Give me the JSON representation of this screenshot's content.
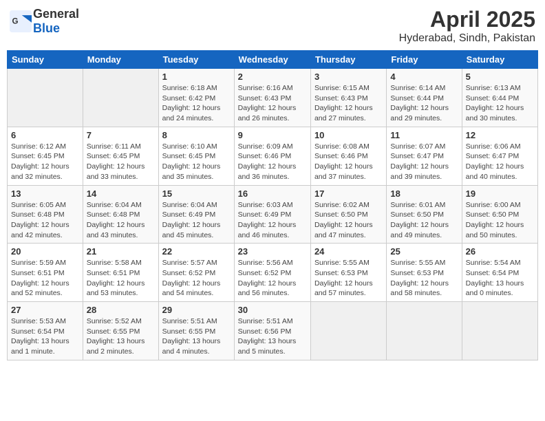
{
  "header": {
    "logo_general": "General",
    "logo_blue": "Blue",
    "month_title": "April 2025",
    "location": "Hyderabad, Sindh, Pakistan"
  },
  "weekdays": [
    "Sunday",
    "Monday",
    "Tuesday",
    "Wednesday",
    "Thursday",
    "Friday",
    "Saturday"
  ],
  "weeks": [
    [
      {
        "day": "",
        "info": ""
      },
      {
        "day": "",
        "info": ""
      },
      {
        "day": "1",
        "info": "Sunrise: 6:18 AM\nSunset: 6:42 PM\nDaylight: 12 hours\nand 24 minutes."
      },
      {
        "day": "2",
        "info": "Sunrise: 6:16 AM\nSunset: 6:43 PM\nDaylight: 12 hours\nand 26 minutes."
      },
      {
        "day": "3",
        "info": "Sunrise: 6:15 AM\nSunset: 6:43 PM\nDaylight: 12 hours\nand 27 minutes."
      },
      {
        "day": "4",
        "info": "Sunrise: 6:14 AM\nSunset: 6:44 PM\nDaylight: 12 hours\nand 29 minutes."
      },
      {
        "day": "5",
        "info": "Sunrise: 6:13 AM\nSunset: 6:44 PM\nDaylight: 12 hours\nand 30 minutes."
      }
    ],
    [
      {
        "day": "6",
        "info": "Sunrise: 6:12 AM\nSunset: 6:45 PM\nDaylight: 12 hours\nand 32 minutes."
      },
      {
        "day": "7",
        "info": "Sunrise: 6:11 AM\nSunset: 6:45 PM\nDaylight: 12 hours\nand 33 minutes."
      },
      {
        "day": "8",
        "info": "Sunrise: 6:10 AM\nSunset: 6:45 PM\nDaylight: 12 hours\nand 35 minutes."
      },
      {
        "day": "9",
        "info": "Sunrise: 6:09 AM\nSunset: 6:46 PM\nDaylight: 12 hours\nand 36 minutes."
      },
      {
        "day": "10",
        "info": "Sunrise: 6:08 AM\nSunset: 6:46 PM\nDaylight: 12 hours\nand 37 minutes."
      },
      {
        "day": "11",
        "info": "Sunrise: 6:07 AM\nSunset: 6:47 PM\nDaylight: 12 hours\nand 39 minutes."
      },
      {
        "day": "12",
        "info": "Sunrise: 6:06 AM\nSunset: 6:47 PM\nDaylight: 12 hours\nand 40 minutes."
      }
    ],
    [
      {
        "day": "13",
        "info": "Sunrise: 6:05 AM\nSunset: 6:48 PM\nDaylight: 12 hours\nand 42 minutes."
      },
      {
        "day": "14",
        "info": "Sunrise: 6:04 AM\nSunset: 6:48 PM\nDaylight: 12 hours\nand 43 minutes."
      },
      {
        "day": "15",
        "info": "Sunrise: 6:04 AM\nSunset: 6:49 PM\nDaylight: 12 hours\nand 45 minutes."
      },
      {
        "day": "16",
        "info": "Sunrise: 6:03 AM\nSunset: 6:49 PM\nDaylight: 12 hours\nand 46 minutes."
      },
      {
        "day": "17",
        "info": "Sunrise: 6:02 AM\nSunset: 6:50 PM\nDaylight: 12 hours\nand 47 minutes."
      },
      {
        "day": "18",
        "info": "Sunrise: 6:01 AM\nSunset: 6:50 PM\nDaylight: 12 hours\nand 49 minutes."
      },
      {
        "day": "19",
        "info": "Sunrise: 6:00 AM\nSunset: 6:50 PM\nDaylight: 12 hours\nand 50 minutes."
      }
    ],
    [
      {
        "day": "20",
        "info": "Sunrise: 5:59 AM\nSunset: 6:51 PM\nDaylight: 12 hours\nand 52 minutes."
      },
      {
        "day": "21",
        "info": "Sunrise: 5:58 AM\nSunset: 6:51 PM\nDaylight: 12 hours\nand 53 minutes."
      },
      {
        "day": "22",
        "info": "Sunrise: 5:57 AM\nSunset: 6:52 PM\nDaylight: 12 hours\nand 54 minutes."
      },
      {
        "day": "23",
        "info": "Sunrise: 5:56 AM\nSunset: 6:52 PM\nDaylight: 12 hours\nand 56 minutes."
      },
      {
        "day": "24",
        "info": "Sunrise: 5:55 AM\nSunset: 6:53 PM\nDaylight: 12 hours\nand 57 minutes."
      },
      {
        "day": "25",
        "info": "Sunrise: 5:55 AM\nSunset: 6:53 PM\nDaylight: 12 hours\nand 58 minutes."
      },
      {
        "day": "26",
        "info": "Sunrise: 5:54 AM\nSunset: 6:54 PM\nDaylight: 13 hours\nand 0 minutes."
      }
    ],
    [
      {
        "day": "27",
        "info": "Sunrise: 5:53 AM\nSunset: 6:54 PM\nDaylight: 13 hours\nand 1 minute."
      },
      {
        "day": "28",
        "info": "Sunrise: 5:52 AM\nSunset: 6:55 PM\nDaylight: 13 hours\nand 2 minutes."
      },
      {
        "day": "29",
        "info": "Sunrise: 5:51 AM\nSunset: 6:55 PM\nDaylight: 13 hours\nand 4 minutes."
      },
      {
        "day": "30",
        "info": "Sunrise: 5:51 AM\nSunset: 6:56 PM\nDaylight: 13 hours\nand 5 minutes."
      },
      {
        "day": "",
        "info": ""
      },
      {
        "day": "",
        "info": ""
      },
      {
        "day": "",
        "info": ""
      }
    ]
  ]
}
